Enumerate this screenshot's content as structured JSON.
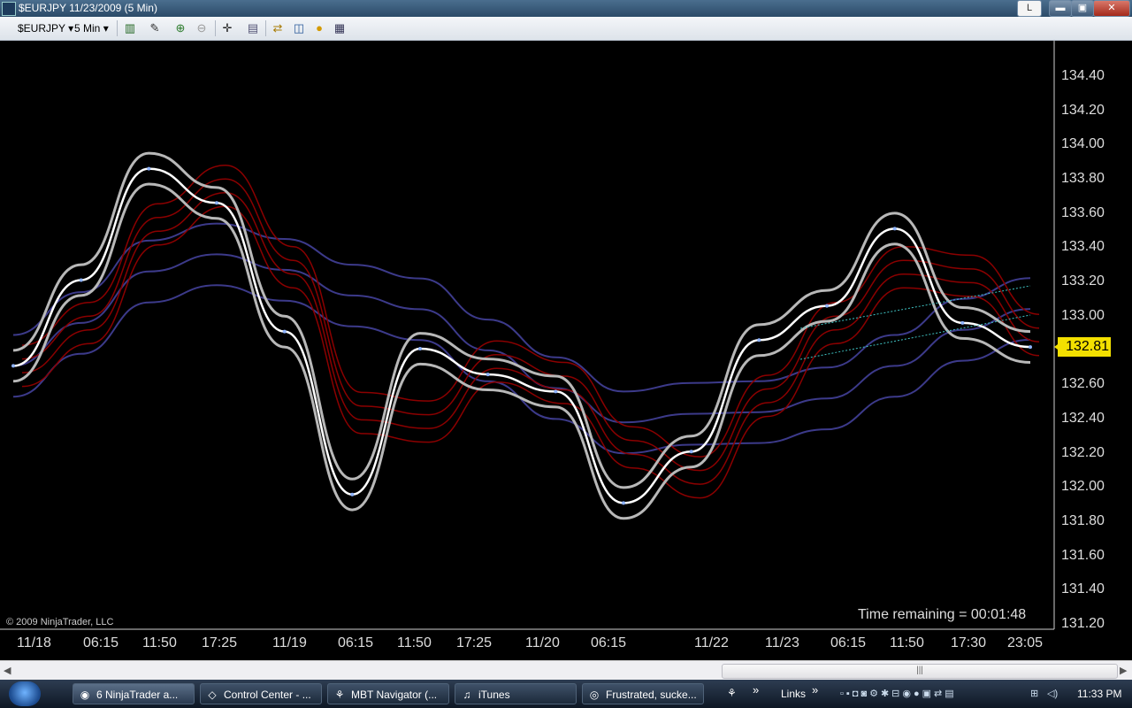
{
  "window": {
    "title": "$EURJPY  11/23/2009 (5 Min)",
    "btn_letter": "L",
    "min_glyph": "▬",
    "max_glyph": "▣",
    "close_glyph": "✕"
  },
  "toolbar": {
    "instrument": "$EURJPY",
    "interval": "5 Min",
    "dropdown_glyph": "▾",
    "icons": [
      "candlestick-icon",
      "draw-pencil-icon",
      "zoom-in-icon",
      "zoom-out-icon",
      "crosshair-icon",
      "properties-icon",
      "strategy-icon",
      "indicators-icon",
      "coin-icon",
      "data-box-icon"
    ]
  },
  "chart": {
    "y_labels": [
      "134.40",
      "134.20",
      "134.00",
      "133.80",
      "133.60",
      "133.40",
      "133.20",
      "133.00",
      "132.60",
      "132.40",
      "132.20",
      "132.00",
      "131.80",
      "131.60",
      "131.40",
      "131.20"
    ],
    "x_labels": [
      "11/18",
      "06:15",
      "11:50",
      "17:25",
      "11/19",
      "06:15",
      "11:50",
      "17:25",
      "11/20",
      "06:15",
      "11/22",
      "11/23",
      "06:15",
      "11:50",
      "17:30",
      "23:05"
    ],
    "current_price": "132.81",
    "copyright": "© 2009 NinjaTrader, LLC",
    "time_remaining": "Time remaining = 00:01:48",
    "colors": {
      "price": "#ffffff",
      "band_gray": "#b8b8b8",
      "band_red": "#8b0000",
      "band_blue": "#3c3a8a",
      "trendline": "#3fc2c2",
      "price_tag": "#f3e000"
    }
  },
  "chart_data": {
    "type": "line",
    "title": "",
    "xlabel": "",
    "ylabel": "",
    "ylim": [
      131.2,
      134.4
    ],
    "x": [
      "11/18",
      "06:15",
      "11:50",
      "17:25",
      "11/19",
      "06:15",
      "11:50",
      "17:25",
      "11/20",
      "06:15",
      "11/22",
      "11/23",
      "06:15",
      "11:50",
      "17:30",
      "23:05"
    ],
    "series": [
      {
        "values": [
          132.7,
          133.2,
          133.85,
          133.65,
          132.9,
          131.95,
          132.8,
          132.65,
          132.55,
          131.9,
          132.2,
          132.85,
          133.05,
          133.5,
          132.95,
          132.81
        ]
      }
    ],
    "grid": false
  },
  "scrollbar": {
    "left_arrow": "◀",
    "right_arrow": "▶",
    "grip": "|||"
  },
  "taskbar": {
    "items": [
      {
        "label": "6 NinjaTrader a...",
        "icon": "ninjatrader-icon"
      },
      {
        "label": "Control Center - ...",
        "icon": "control-center-icon"
      },
      {
        "label": "MBT Navigator (...",
        "icon": "mbt-navigator-icon"
      },
      {
        "label": "iTunes",
        "icon": "itunes-icon"
      },
      {
        "label": "Frustrated, sucke...",
        "icon": "chrome-icon"
      }
    ],
    "links_label": "Links",
    "chevron": "»",
    "clock": "11:33 PM"
  }
}
